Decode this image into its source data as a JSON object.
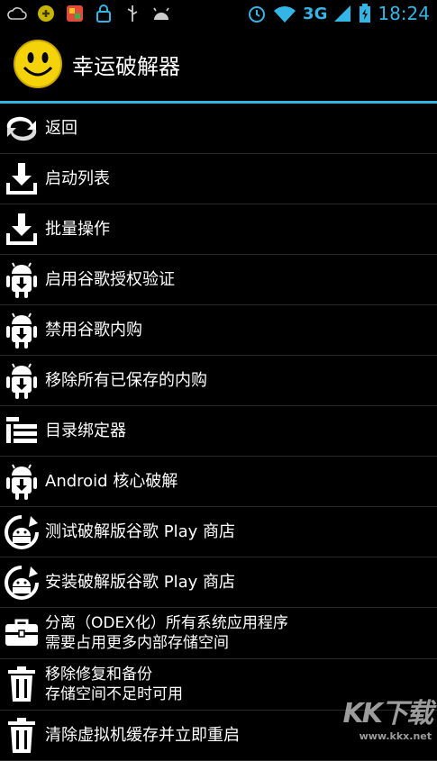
{
  "status": {
    "network": "3G",
    "time": "18:24"
  },
  "app": {
    "title": "幸运破解器"
  },
  "menu": [
    {
      "icon": "back-arrows-icon",
      "label": "返回"
    },
    {
      "icon": "download-tray-icon",
      "label": "启动列表"
    },
    {
      "icon": "download-tray-icon",
      "label": "批量操作"
    },
    {
      "icon": "android-download-icon",
      "label": "启用谷歌授权验证"
    },
    {
      "icon": "android-download-icon",
      "label": "禁用谷歌内购"
    },
    {
      "icon": "android-download-icon",
      "label": "移除所有已保存的内购"
    },
    {
      "icon": "list-bars-icon",
      "label": "目录绑定器"
    },
    {
      "icon": "android-download-icon",
      "label": "Android 核心破解"
    },
    {
      "icon": "android-refresh-icon",
      "label": "测试破解版谷歌 Play 商店"
    },
    {
      "icon": "android-refresh-icon",
      "label": "安装破解版谷歌 Play 商店"
    },
    {
      "icon": "toolbox-icon",
      "label": "分离（ODEX化）所有系统应用程序",
      "sub": "需要占用更多内部存储空间"
    },
    {
      "icon": "trash-icon",
      "label": "移除修复和备份",
      "sub": "存储空间不足时可用"
    },
    {
      "icon": "trash-icon",
      "label": "清除虚拟机缓存并立即重启"
    }
  ],
  "watermark": {
    "text": "KK下载",
    "url": "www.kkx.net"
  },
  "colors": {
    "accent": "#33b5e5",
    "background": "#000000"
  }
}
